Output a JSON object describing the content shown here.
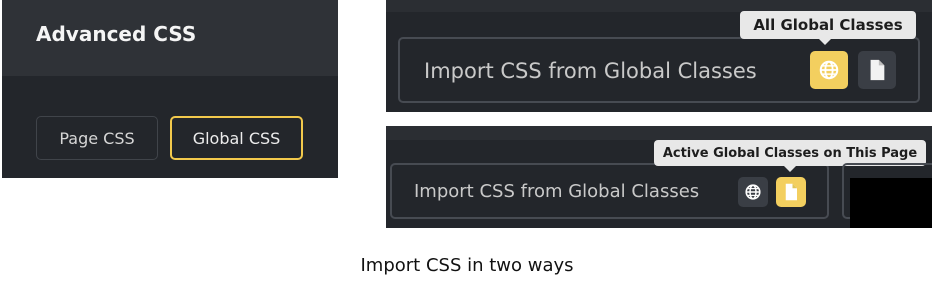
{
  "left_panel": {
    "title": "Advanced CSS",
    "tabs": [
      {
        "label": "Page CSS",
        "active": false
      },
      {
        "label": "Global CSS",
        "active": true
      }
    ]
  },
  "import_top": {
    "label": "Import CSS from Global Classes",
    "tooltip": "All Global Classes",
    "active_button": "globe-icon",
    "buttons": [
      "globe-icon",
      "page-icon"
    ]
  },
  "import_bottom": {
    "label": "Import CSS from Global Classes",
    "tooltip": "Active Global Classes on This Page",
    "active_button": "page-icon",
    "buttons": [
      "globe-icon",
      "page-icon"
    ]
  },
  "caption": "Import CSS in two ways",
  "colors": {
    "accent": "#f3cf5f",
    "panel_bg": "#23262b",
    "header_bg": "#2f3237",
    "tooltip_bg": "#e8e8e8"
  }
}
